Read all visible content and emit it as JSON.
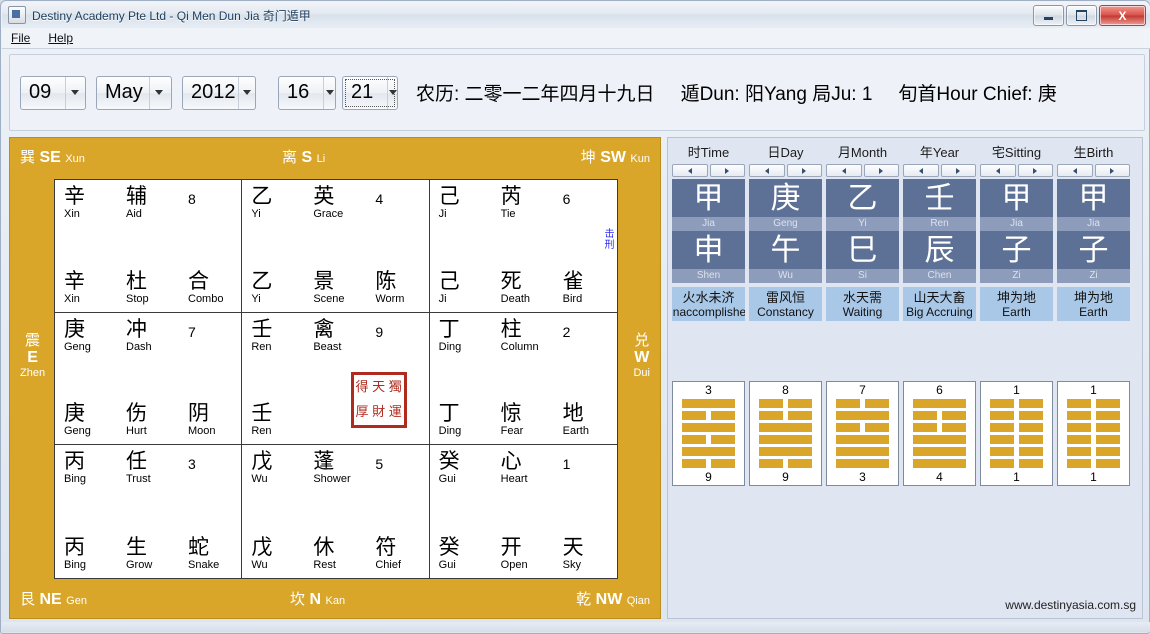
{
  "window": {
    "title": "Destiny Academy Pte Ltd - Qi Men Dun Jia 奇门遁甲",
    "app_icon": "app-icon",
    "minimize_label": "Minimize",
    "maximize_label": "Maximize",
    "close_label": "X"
  },
  "menu": {
    "items": [
      {
        "label": "File"
      },
      {
        "label": "Help"
      }
    ]
  },
  "toolbar": {
    "day": "09",
    "month": "May",
    "year": "2012",
    "hour": "16",
    "minute": "21",
    "lunar": "农历: 二零一二年四月十九日",
    "dun": "遁Dun: 阳Yang 局Ju:  1",
    "hour_chief": "旬首Hour Chief: 庚"
  },
  "chart": {
    "corners": {
      "se": {
        "cn": "巽",
        "abbr": "SE",
        "py": "Xun"
      },
      "s": {
        "cn": "离",
        "abbr": "S",
        "py": "Li"
      },
      "sw": {
        "cn": "坤",
        "abbr": "SW",
        "py": "Kun"
      },
      "e": {
        "cn": "震",
        "abbr": "E",
        "py": "Zhen"
      },
      "w": {
        "cn": "兑",
        "abbr": "W",
        "py": "Dui"
      },
      "ne": {
        "cn": "艮",
        "abbr": "NE",
        "py": "Gen"
      },
      "n": {
        "cn": "坎",
        "abbr": "N",
        "py": "Kan"
      },
      "nw": {
        "cn": "乾",
        "abbr": "NW",
        "py": "Qian"
      }
    },
    "cells": [
      {
        "num": "8",
        "top": [
          {
            "cn": "辛",
            "py": "Xin"
          },
          {
            "cn": "辅",
            "py": "Aid"
          }
        ],
        "bottom": [
          {
            "cn": "辛",
            "py": "Xin"
          },
          {
            "cn": "杜",
            "py": "Stop"
          },
          {
            "cn": "合",
            "py": "Combo"
          }
        ],
        "note": ""
      },
      {
        "num": "4",
        "top": [
          {
            "cn": "乙",
            "py": "Yi"
          },
          {
            "cn": "英",
            "py": "Grace"
          }
        ],
        "bottom": [
          {
            "cn": "乙",
            "py": "Yi"
          },
          {
            "cn": "景",
            "py": "Scene"
          },
          {
            "cn": "陈",
            "py": "Worm"
          }
        ],
        "note": ""
      },
      {
        "num": "6",
        "top": [
          {
            "cn": "己",
            "py": "Ji"
          },
          {
            "cn": "芮",
            "py": "Tie"
          }
        ],
        "bottom": [
          {
            "cn": "己",
            "py": "Ji"
          },
          {
            "cn": "死",
            "py": "Death"
          },
          {
            "cn": "雀",
            "py": "Bird"
          }
        ],
        "note": "击刑"
      },
      {
        "num": "7",
        "top": [
          {
            "cn": "庚",
            "py": "Geng"
          },
          {
            "cn": "冲",
            "py": "Dash"
          }
        ],
        "bottom": [
          {
            "cn": "庚",
            "py": "Geng"
          },
          {
            "cn": "伤",
            "py": "Hurt"
          },
          {
            "cn": "阴",
            "py": "Moon"
          }
        ],
        "note": ""
      },
      {
        "num": "9",
        "top": [
          {
            "cn": "壬",
            "py": "Ren"
          },
          {
            "cn": "禽",
            "py": "Beast"
          }
        ],
        "bottom": [
          {
            "cn": "壬",
            "py": "Ren"
          }
        ],
        "note": "",
        "seal": [
          "得",
          "天",
          "獨",
          "厚",
          "財",
          "運"
        ]
      },
      {
        "num": "2",
        "top": [
          {
            "cn": "丁",
            "py": "Ding"
          },
          {
            "cn": "柱",
            "py": "Column"
          }
        ],
        "bottom": [
          {
            "cn": "丁",
            "py": "Ding"
          },
          {
            "cn": "惊",
            "py": "Fear"
          },
          {
            "cn": "地",
            "py": "Earth"
          }
        ],
        "note": ""
      },
      {
        "num": "3",
        "top": [
          {
            "cn": "丙",
            "py": "Bing"
          },
          {
            "cn": "任",
            "py": "Trust"
          }
        ],
        "bottom": [
          {
            "cn": "丙",
            "py": "Bing"
          },
          {
            "cn": "生",
            "py": "Grow"
          },
          {
            "cn": "蛇",
            "py": "Snake"
          }
        ],
        "note": ""
      },
      {
        "num": "5",
        "top": [
          {
            "cn": "戊",
            "py": "Wu"
          },
          {
            "cn": "蓬",
            "py": "Shower"
          }
        ],
        "bottom": [
          {
            "cn": "戊",
            "py": "Wu"
          },
          {
            "cn": "休",
            "py": "Rest"
          },
          {
            "cn": "符",
            "py": "Chief"
          }
        ],
        "note": ""
      },
      {
        "num": "1",
        "top": [
          {
            "cn": "癸",
            "py": "Gui"
          },
          {
            "cn": "心",
            "py": "Heart"
          }
        ],
        "bottom": [
          {
            "cn": "癸",
            "py": "Gui"
          },
          {
            "cn": "开",
            "py": "Open"
          },
          {
            "cn": "天",
            "py": "Sky"
          }
        ],
        "note": ""
      }
    ]
  },
  "pillars": [
    {
      "head": "时Time",
      "stem_cn": "甲",
      "stem_py": "Jia",
      "branch_cn": "申",
      "branch_py": "Shen",
      "hex_cn": "火水未济",
      "hex_en": "Unaccomplished",
      "top_num": "3",
      "bot_num": "9",
      "lines": [
        "solid",
        "broken",
        "solid",
        "broken",
        "solid",
        "broken"
      ]
    },
    {
      "head": "日Day",
      "stem_cn": "庚",
      "stem_py": "Geng",
      "branch_cn": "午",
      "branch_py": "Wu",
      "hex_cn": "雷风恒",
      "hex_en": "Constancy",
      "top_num": "8",
      "bot_num": "9",
      "lines": [
        "broken",
        "broken",
        "solid",
        "solid",
        "solid",
        "broken"
      ]
    },
    {
      "head": "月Month",
      "stem_cn": "乙",
      "stem_py": "Yi",
      "branch_cn": "巳",
      "branch_py": "Si",
      "hex_cn": "水天需",
      "hex_en": "Waiting",
      "top_num": "7",
      "bot_num": "3",
      "lines": [
        "broken",
        "solid",
        "broken",
        "solid",
        "solid",
        "solid"
      ]
    },
    {
      "head": "年Year",
      "stem_cn": "壬",
      "stem_py": "Ren",
      "branch_cn": "辰",
      "branch_py": "Chen",
      "hex_cn": "山天大畜",
      "hex_en": "Big Accruing",
      "top_num": "6",
      "bot_num": "4",
      "lines": [
        "solid",
        "broken",
        "broken",
        "solid",
        "solid",
        "solid"
      ]
    },
    {
      "head": "宅Sitting",
      "stem_cn": "甲",
      "stem_py": "Jia",
      "branch_cn": "子",
      "branch_py": "Zi",
      "hex_cn": "坤为地",
      "hex_en": "Earth",
      "top_num": "1",
      "bot_num": "1",
      "lines": [
        "broken",
        "broken",
        "broken",
        "broken",
        "broken",
        "broken"
      ]
    },
    {
      "head": "生Birth",
      "stem_cn": "甲",
      "stem_py": "Jia",
      "branch_cn": "子",
      "branch_py": "Zi",
      "hex_cn": "坤为地",
      "hex_en": "Earth",
      "top_num": "1",
      "bot_num": "1",
      "lines": [
        "broken",
        "broken",
        "broken",
        "broken",
        "broken",
        "broken"
      ]
    }
  ],
  "footer": {
    "url": "www.destinyasia.com.sg"
  },
  "colors": {
    "gold": "#d9a629",
    "panel_blue": "#dfe5f1",
    "pillar_blue": "#5d7096",
    "hex_label": "#a9c8e8",
    "note": "#2d2df0"
  }
}
